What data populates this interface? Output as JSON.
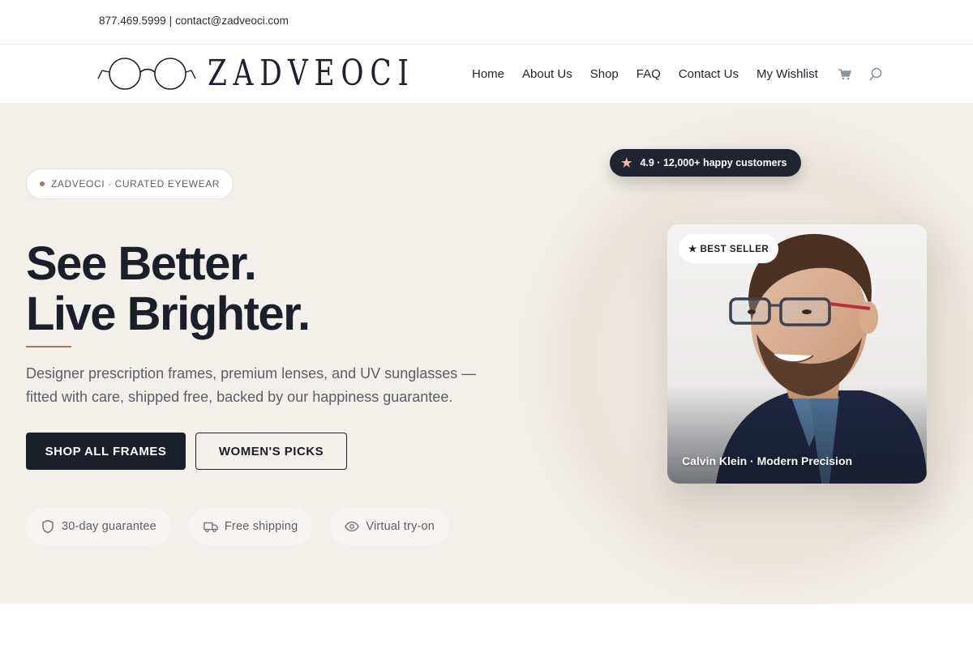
{
  "topbar": {
    "phone": "877.469.5999",
    "separator": "|",
    "email": "contact@zadveoci.com"
  },
  "brand": {
    "name": "ZADVEOCI",
    "logo_icon": "round-glasses-icon"
  },
  "nav": {
    "items": [
      {
        "label": "Home"
      },
      {
        "label": "About Us"
      },
      {
        "label": "Shop"
      },
      {
        "label": "FAQ"
      },
      {
        "label": "Contact Us"
      },
      {
        "label": "My Wishlist"
      }
    ],
    "cart_icon": "cart-icon",
    "search_icon": "search-icon"
  },
  "hero": {
    "eyebrow": "ZADVEOCI · CURATED EYEWEAR",
    "headline_line1": "See Better.",
    "headline_line2": "Live Brighter.",
    "subtext": "Designer prescription frames, premium lenses, and UV sunglasses — fitted with care, shipped free, backed by our happiness guarantee.",
    "primary_cta": "SHOP ALL FRAMES",
    "secondary_cta": "WOMEN'S PICKS",
    "features": [
      {
        "icon": "shield-icon",
        "label": "30-day guarantee"
      },
      {
        "icon": "truck-icon",
        "label": "Free shipping"
      },
      {
        "icon": "eye-icon",
        "label": "Virtual try-on"
      }
    ],
    "rating": {
      "icon": "star-icon",
      "text": "4.9 · 12,000+ happy customers"
    },
    "product_card": {
      "badge": "★ BEST SELLER",
      "caption": "Calvin Klein · Modern Precision"
    }
  },
  "colors": {
    "dark": "#1b1f2a",
    "accent": "#a07b5a",
    "hero_bg": "#f3efea",
    "star": "#f3b7a4"
  }
}
